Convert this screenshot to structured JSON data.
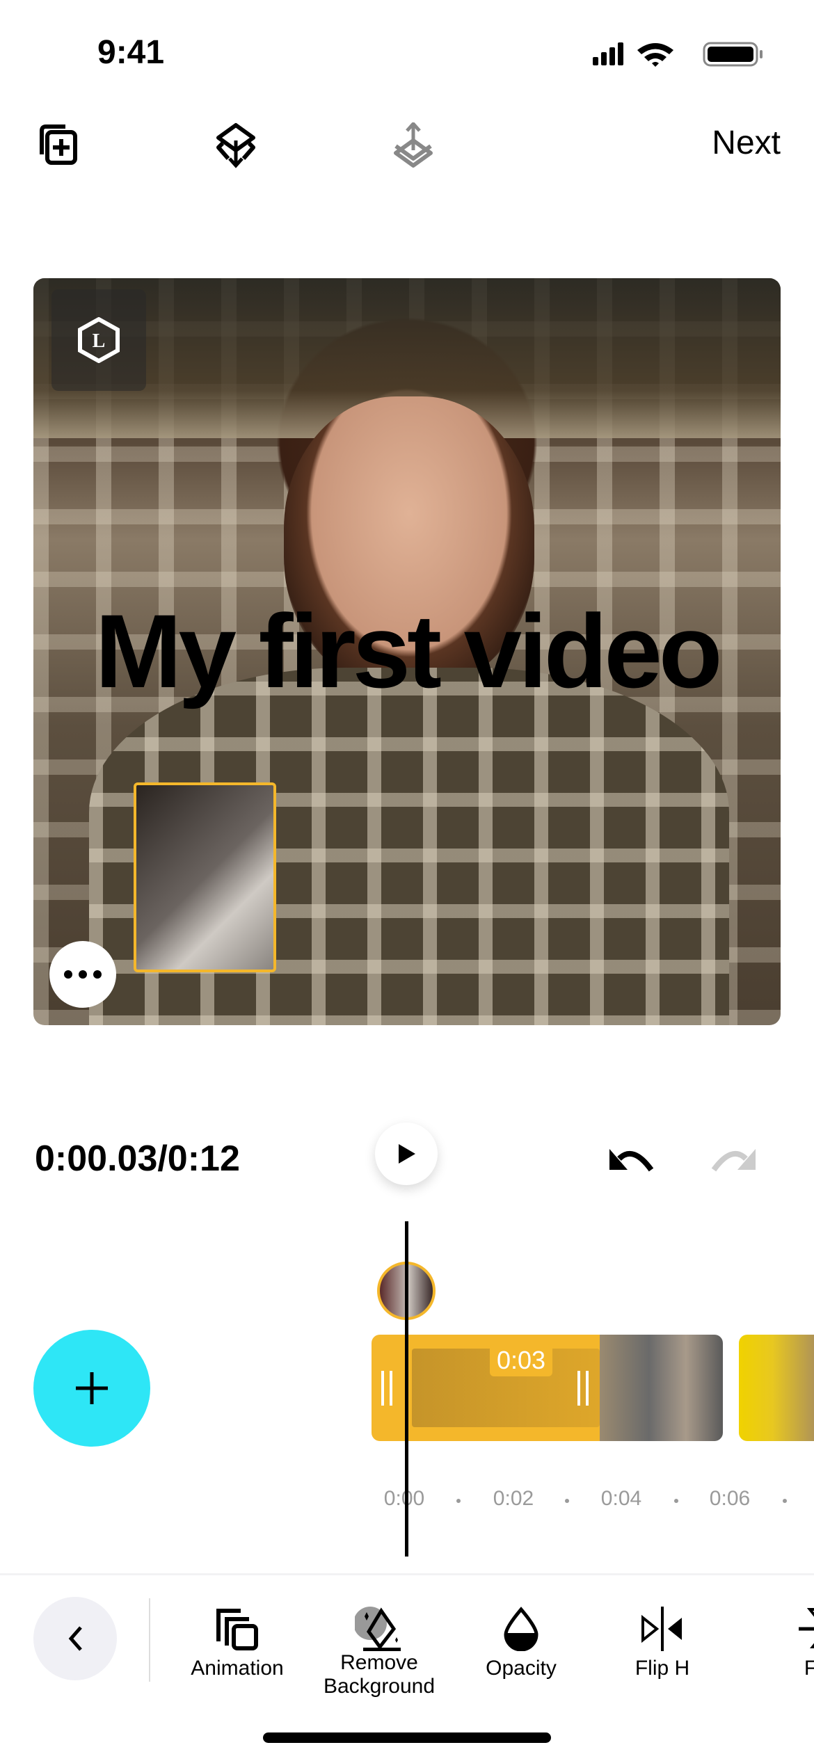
{
  "status_bar": {
    "time": "9:41"
  },
  "top_bar": {
    "icons": [
      "add-layer-icon",
      "import-icon",
      "export-icon"
    ],
    "next_label": "Next"
  },
  "preview": {
    "title_text": "My first video",
    "badge_letter": "L"
  },
  "playback": {
    "timecode": "0:00.03/0:12"
  },
  "timeline": {
    "selected_clip_duration": "0:03",
    "ticks": [
      "0:00",
      "0:02",
      "0:04",
      "0:06"
    ],
    "accent_color": "#f4b72b"
  },
  "add_button_color": "#2ee6f6",
  "tools": [
    {
      "label": "Animation"
    },
    {
      "label": "Remove\nBackground"
    },
    {
      "label": "Opacity"
    },
    {
      "label": "Flip H"
    },
    {
      "label": "Flip"
    }
  ]
}
